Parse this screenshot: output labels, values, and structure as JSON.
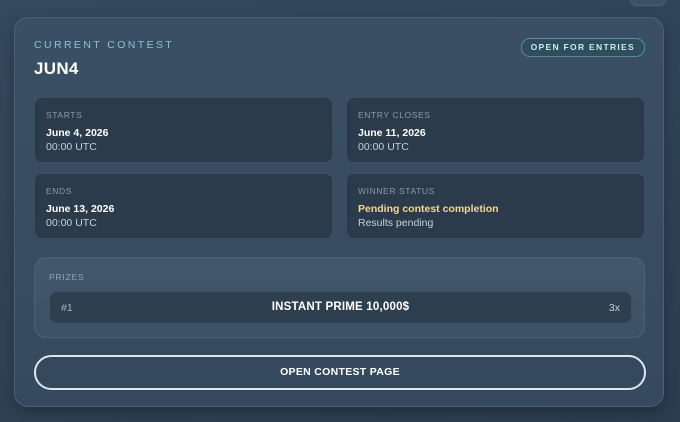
{
  "contest": {
    "eyebrow": "CURRENT CONTEST",
    "title": "JUN4",
    "status": "OPEN FOR ENTRIES"
  },
  "info": {
    "starts": {
      "label": "STARTS",
      "date": "June 4, 2026",
      "time": "00:00 UTC"
    },
    "entry_closes": {
      "label": "ENTRY CLOSES",
      "date": "June 11, 2026",
      "time": "00:00 UTC"
    },
    "ends": {
      "label": "ENDS",
      "date": "June 13, 2026",
      "time": "00:00 UTC"
    },
    "winner_status": {
      "label": "WINNER STATUS",
      "status": "Pending contest completion",
      "detail": "Results pending"
    }
  },
  "prizes": {
    "label": "PRIZES",
    "items": [
      {
        "rank": "#1",
        "name": "INSTANT PRIME 10,000$",
        "quantity": "3x"
      }
    ]
  },
  "cta": {
    "label": "OPEN CONTEST PAGE"
  },
  "colors": {
    "accent_eyebrow": "#8fc0d8",
    "warning_text": "#f5d98a",
    "card_background": "#3a4f64",
    "box_background": "#2b3b4c"
  }
}
